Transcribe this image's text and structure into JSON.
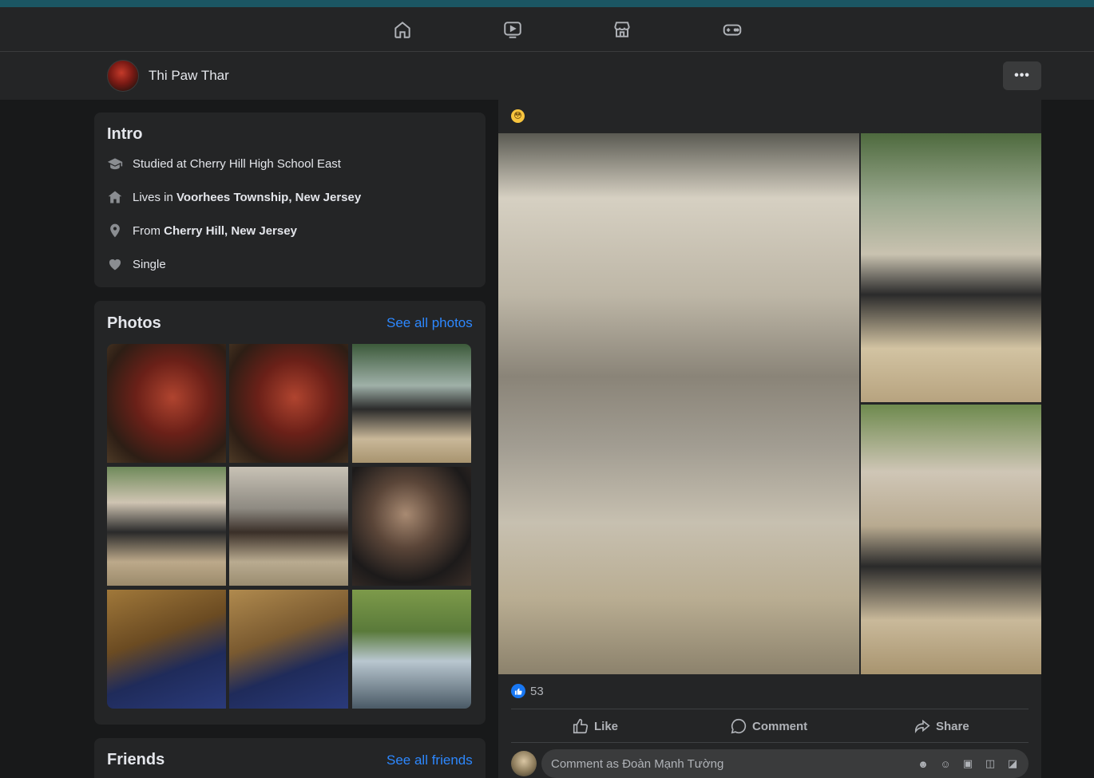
{
  "nav": {
    "icons": [
      "home-icon",
      "video-icon",
      "marketplace-icon",
      "gaming-icon"
    ]
  },
  "profile": {
    "name": "Thi Paw Thar",
    "more_label": "•••"
  },
  "intro": {
    "title": "Intro",
    "studied": "Studied at Cherry Hill High School East",
    "lives_prefix": "Lives in ",
    "lives_place": "Voorhees Township, New Jersey",
    "from_prefix": "From ",
    "from_place": "Cherry Hill, New Jersey",
    "relationship": "Single"
  },
  "photos": {
    "title": "Photos",
    "see_all": "See all photos"
  },
  "friends": {
    "title": "Friends",
    "see_all": "See all friends"
  },
  "post": {
    "reaction_count": "53",
    "like_label": "Like",
    "comment_label": "Comment",
    "share_label": "Share",
    "comment_placeholder": "Comment as Đoàn Mạnh Tường"
  },
  "colors": {
    "accent": "#2d88ff",
    "card_bg": "#242526",
    "page_bg": "#18191a"
  }
}
